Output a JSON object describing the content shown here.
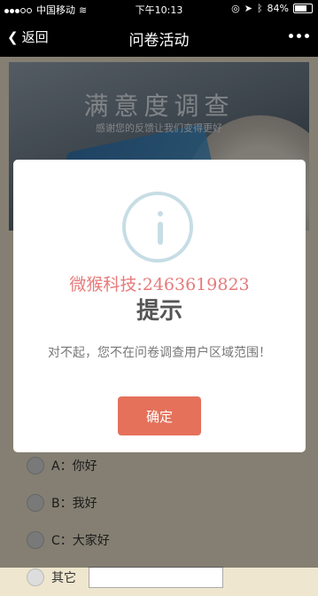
{
  "status_bar": {
    "carrier": "中国移动",
    "time": "下午10:13",
    "battery": "84%",
    "battery_level": 0.84
  },
  "nav": {
    "back_label": "返回",
    "title": "问卷活动"
  },
  "banner": {
    "title": "满意度调查",
    "subtitle": "感谢您的反馈让我们变得更好"
  },
  "options": [
    {
      "label": "A：你好"
    },
    {
      "label": "B：我好"
    },
    {
      "label": "C：大家好"
    },
    {
      "label": "其它"
    }
  ],
  "modal": {
    "watermark": "微猴科技:2463619823",
    "title": "提示",
    "message": "对不起，您不在问卷调查用户区域范围！",
    "confirm_label": "确定"
  }
}
